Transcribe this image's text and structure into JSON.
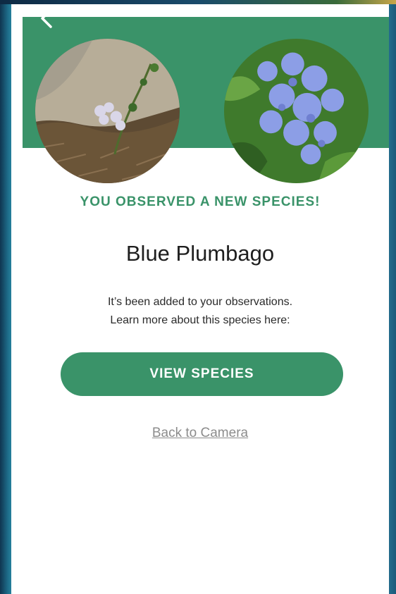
{
  "header": {
    "back_icon": "chevron-left-icon",
    "accent_color": "#3a9369"
  },
  "photos": {
    "observed": "user-photo-plant",
    "reference": "reference-photo-blue-plumbago"
  },
  "result": {
    "headline": "YOU OBSERVED A NEW SPECIES!",
    "species_name": "Blue Plumbago",
    "message_line1": "It’s been added to your observations.",
    "message_line2": "Learn more about this species here:"
  },
  "actions": {
    "view_species_label": "VIEW SPECIES",
    "back_to_camera_label": "Back to Camera"
  }
}
